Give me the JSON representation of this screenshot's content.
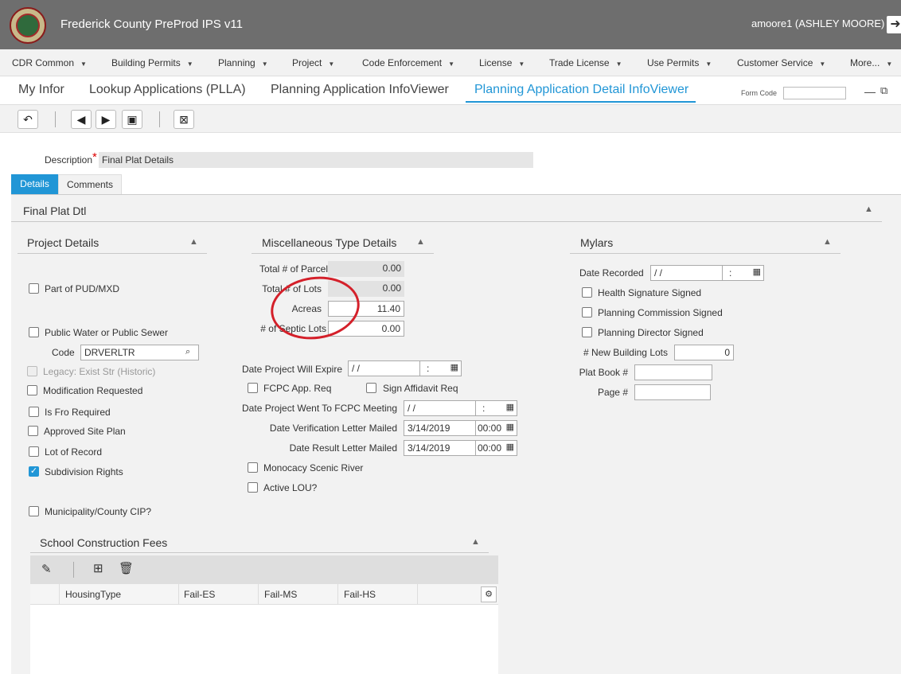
{
  "header": {
    "app_title": "Frederick County PreProd IPS v11",
    "user": "amoore1 (ASHLEY MOORE)",
    "logout_icon": "logout-icon"
  },
  "menu": [
    {
      "label": "CDR Common"
    },
    {
      "label": "Building Permits"
    },
    {
      "label": "Planning"
    },
    {
      "label": "Project"
    },
    {
      "label": "Code Enforcement"
    },
    {
      "label": "License"
    },
    {
      "label": "Trade License"
    },
    {
      "label": "Use Permits"
    },
    {
      "label": "Customer Service"
    },
    {
      "label": "More..."
    }
  ],
  "tabs": [
    {
      "label": "My Infor"
    },
    {
      "label": "Lookup Applications (PLLA)"
    },
    {
      "label": "Planning Application InfoViewer"
    },
    {
      "label": "Planning Application Detail InfoViewer"
    }
  ],
  "form_code": {
    "label": "Form Code",
    "value": ""
  },
  "description": {
    "label": "Description",
    "required": "*",
    "value": "Final Plat Details"
  },
  "detail_tabs": {
    "details": "Details",
    "comments": "Comments"
  },
  "panel_title": "Final Plat Dtl",
  "project_details": {
    "title": "Project Details",
    "part_of_pud": {
      "label": "Part of PUD/MXD",
      "checked": false
    },
    "public_water": {
      "label": "Public Water or Public Sewer",
      "checked": false
    },
    "code": {
      "label": "Code",
      "value": "DRVERLTR"
    },
    "legacy": {
      "label": "Legacy: Exist Str (Historic)",
      "checked": false
    },
    "modification": {
      "label": "Modification Requested",
      "checked": false
    },
    "is_fro": {
      "label": "Is Fro Required",
      "checked": false
    },
    "approved_site_plan": {
      "label": "Approved Site Plan",
      "checked": false
    },
    "lot_of_record": {
      "label": "Lot of Record",
      "checked": false
    },
    "subdivision_rights": {
      "label": "Subdivision Rights",
      "checked": true,
      "check_mark": "✓"
    },
    "municipality": {
      "label": "Municipality/County CIP?",
      "checked": false
    }
  },
  "misc": {
    "title": "Miscellaneous Type Details",
    "total_parcel": {
      "label": "Total # of Parcel",
      "value": "0.00"
    },
    "total_lots": {
      "label": "Total # of Lots",
      "value": "0.00"
    },
    "acreas": {
      "label": "Acreas",
      "value": "11.40"
    },
    "septic_lots": {
      "label": "# of Septic Lots",
      "value": "0.00"
    },
    "date_expire": {
      "label": "Date Project Will Expire",
      "date": "/ /",
      "time": ":"
    },
    "fcpc_req": {
      "label": "FCPC App. Req",
      "checked": false
    },
    "sign_affidavit": {
      "label": "Sign Affidavit Req",
      "checked": false
    },
    "date_fcpc": {
      "label": "Date Project Went To FCPC Meeting",
      "date": "/ /",
      "time": ":"
    },
    "date_verification": {
      "label": "Date Verification Letter Mailed",
      "date": "3/14/2019",
      "time": "00:00"
    },
    "date_result": {
      "label": "Date Result Letter Mailed",
      "date": "3/14/2019",
      "time": "00:00"
    },
    "monocacy": {
      "label": "Monocacy Scenic River",
      "checked": false
    },
    "active_lou": {
      "label": "Active LOU?",
      "checked": false
    }
  },
  "mylars": {
    "title": "Mylars",
    "date_recorded": {
      "label": "Date Recorded",
      "date": "/ /",
      "time": ":"
    },
    "health_signature": {
      "label": "Health Signature Signed",
      "checked": false
    },
    "planning_commission": {
      "label": "Planning Commission Signed",
      "checked": false
    },
    "planning_director": {
      "label": "Planning Director Signed",
      "checked": false
    },
    "new_building_lots": {
      "label": "# New Building Lots",
      "value": "0"
    },
    "plat_book": {
      "label": "Plat Book #",
      "value": ""
    },
    "page": {
      "label": "Page #",
      "value": ""
    }
  },
  "school_fees": {
    "title": "School Construction Fees",
    "columns": [
      "HousingType",
      "Fail-ES",
      "Fail-MS",
      "Fail-HS"
    ]
  },
  "colors": {
    "accent": "#2196d6",
    "header_bg": "#6e6e6e",
    "annotation": "#d4202a"
  }
}
